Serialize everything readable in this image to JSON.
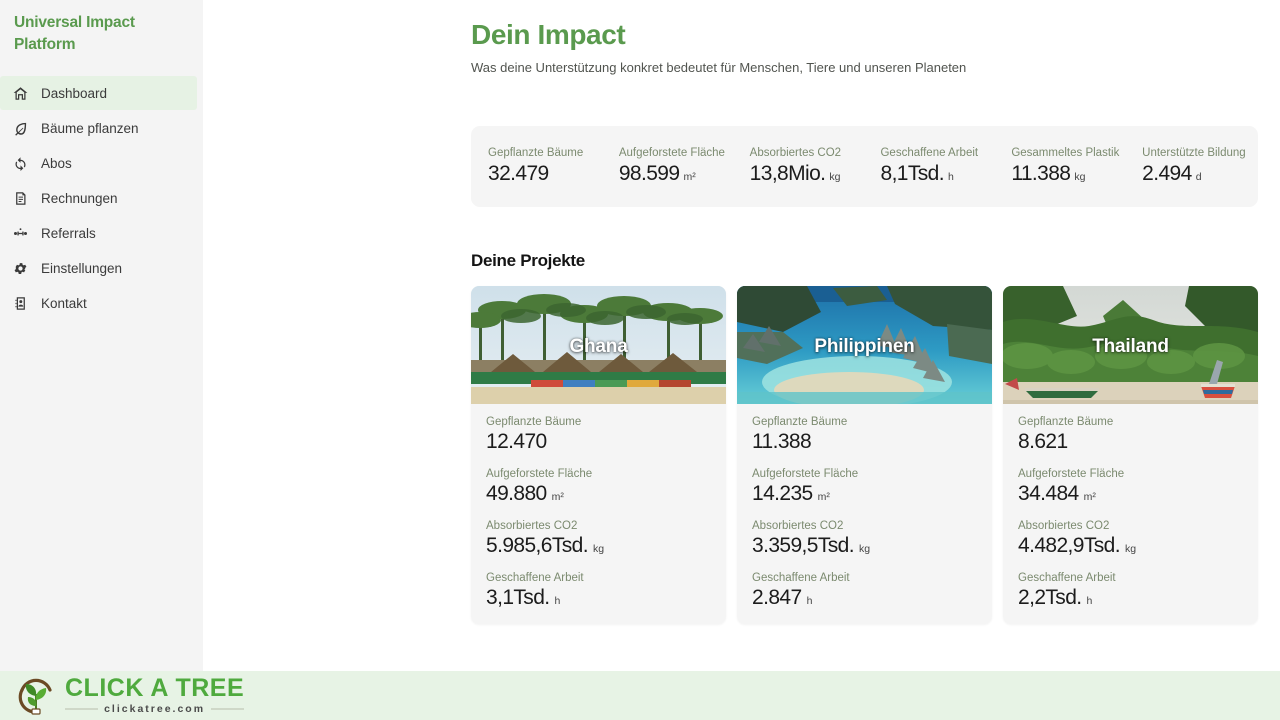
{
  "sidebar": {
    "brand": "Universal Impact Platform",
    "items": [
      {
        "label": "Dashboard",
        "icon": "home-icon",
        "active": true
      },
      {
        "label": "Bäume pflanzen",
        "icon": "leaf-icon",
        "active": false
      },
      {
        "label": "Abos",
        "icon": "sync-icon",
        "active": false
      },
      {
        "label": "Rechnungen",
        "icon": "invoice-icon",
        "active": false
      },
      {
        "label": "Referrals",
        "icon": "referral-icon",
        "active": false
      },
      {
        "label": "Einstellungen",
        "icon": "gear-icon",
        "active": false
      },
      {
        "label": "Kontakt",
        "icon": "contact-icon",
        "active": false
      }
    ]
  },
  "header": {
    "title": "Dein Impact",
    "subtitle": "Was deine Unterstützung konkret bedeutet für Menschen, Tiere und unseren Planeten"
  },
  "stats": [
    {
      "label": "Gepflanzte Bäume",
      "value": "32.479",
      "unit": ""
    },
    {
      "label": "Aufgeforstete Fläche",
      "value": "98.599",
      "unit": "m²"
    },
    {
      "label": "Absorbiertes CO2",
      "value": "13,8Mio.",
      "unit": "kg"
    },
    {
      "label": "Geschaffene Arbeit",
      "value": "8,1Tsd.",
      "unit": "h"
    },
    {
      "label": "Gesammeltes Plastik",
      "value": "11.388",
      "unit": "kg"
    },
    {
      "label": "Unterstützte Bildung",
      "value": "2.494",
      "unit": "d"
    }
  ],
  "projects": {
    "section_title": "Deine Projekte",
    "cards": [
      {
        "country": "Ghana",
        "scene": "beach-palms-huts",
        "metrics": [
          {
            "label": "Gepflanzte Bäume",
            "value": "12.470",
            "unit": ""
          },
          {
            "label": "Aufgeforstete Fläche",
            "value": "49.880",
            "unit": "m²"
          },
          {
            "label": "Absorbiertes CO2",
            "value": "5.985,6Tsd.",
            "unit": "kg"
          },
          {
            "label": "Geschaffene Arbeit",
            "value": "3,1Tsd.",
            "unit": "h"
          }
        ]
      },
      {
        "country": "Philippinen",
        "scene": "lagoon-karst",
        "metrics": [
          {
            "label": "Gepflanzte Bäume",
            "value": "11.388",
            "unit": ""
          },
          {
            "label": "Aufgeforstete Fläche",
            "value": "14.235",
            "unit": "m²"
          },
          {
            "label": "Absorbiertes CO2",
            "value": "3.359,5Tsd.",
            "unit": "kg"
          },
          {
            "label": "Geschaffene Arbeit",
            "value": "2.847",
            "unit": "h"
          }
        ]
      },
      {
        "country": "Thailand",
        "scene": "cliffs-longtail-boats",
        "metrics": [
          {
            "label": "Gepflanzte Bäume",
            "value": "8.621",
            "unit": ""
          },
          {
            "label": "Aufgeforstete Fläche",
            "value": "34.484",
            "unit": "m²"
          },
          {
            "label": "Absorbiertes CO2",
            "value": "4.482,9Tsd.",
            "unit": "kg"
          },
          {
            "label": "Geschaffene Arbeit",
            "value": "2,2Tsd.",
            "unit": "h"
          }
        ]
      }
    ]
  },
  "footer": {
    "logo_wordmark": "CLICK A TREE",
    "logo_domain": "clickatree.com",
    "logo_icon": "sapling-in-circle-icon"
  },
  "colors": {
    "brand_green": "#5a9a4e",
    "logo_green": "#4faa3e",
    "label_green": "#7b8a6f",
    "active_nav_bg": "#e6f2e4",
    "sidebar_bg": "#f4f4f4",
    "card_bg": "#f5f5f5",
    "footer_bg": "#e7f3e5"
  }
}
